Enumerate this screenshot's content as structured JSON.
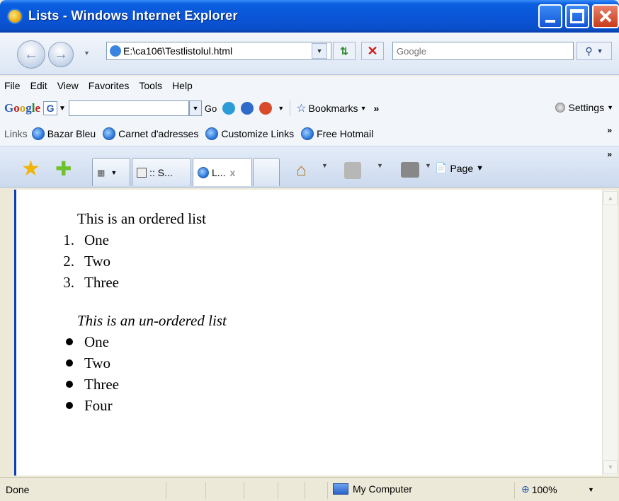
{
  "window": {
    "title": "Lists - Windows Internet Explorer"
  },
  "address_bar": {
    "url": "E:\\ca106\\Testlistolul.html",
    "search_placeholder": "Google"
  },
  "menu": [
    "File",
    "Edit",
    "View",
    "Favorites",
    "Tools",
    "Help"
  ],
  "google_toolbar": {
    "logo": "Google",
    "go_label": "Go",
    "bookmarks_label": "Bookmarks",
    "settings_label": "Settings"
  },
  "links_bar": {
    "label": "Links",
    "links": [
      "Bazar Bleu",
      "Carnet d'adresses",
      "Customize Links",
      "Free Hotmail"
    ]
  },
  "tabs": [
    {
      "label": ":: S..."
    },
    {
      "label": "L...",
      "close": "x"
    }
  ],
  "command_bar": {
    "page_label": "Page"
  },
  "document": {
    "ordered_heading": "This is an ordered list",
    "ordered_items": [
      {
        "num": "1.",
        "text": "One"
      },
      {
        "num": "2.",
        "text": "Two"
      },
      {
        "num": "3.",
        "text": "Three"
      }
    ],
    "unordered_heading": "This is an un-ordered list",
    "unordered_items": [
      "One",
      "Two",
      "Three",
      "Four"
    ]
  },
  "status_bar": {
    "status": "Done",
    "zone": "My Computer",
    "zoom": "100%"
  }
}
